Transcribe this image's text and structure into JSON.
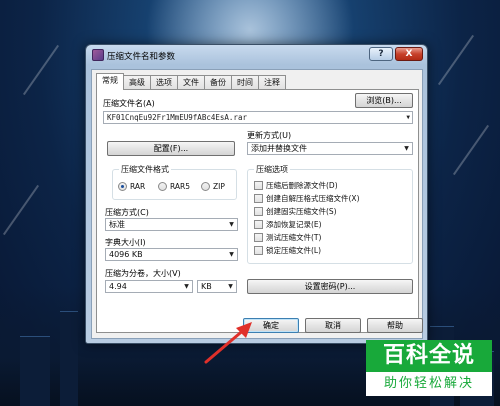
{
  "window": {
    "title": "压缩文件名和参数",
    "help_label": "?",
    "close_label": "X"
  },
  "tabs": [
    "常规",
    "高级",
    "选项",
    "文件",
    "备份",
    "时间",
    "注释"
  ],
  "general": {
    "archive_name_label": "压缩文件名(A)",
    "browse_label": "浏览(B)...",
    "archive_name_value": "KF01CnqEu92Fr1MmEU9fABc4EsA.rar",
    "update_mode_label": "更新方式(U)",
    "update_mode_value": "添加并替换文件",
    "profiles_label": "配置(F)...",
    "format_group_label": "压缩文件格式",
    "formats": [
      {
        "label": "RAR",
        "selected": true
      },
      {
        "label": "RAR5",
        "selected": false
      },
      {
        "label": "ZIP",
        "selected": false
      }
    ],
    "method_label": "压缩方式(C)",
    "method_value": "标准",
    "dict_label": "字典大小(I)",
    "dict_value": "4096 KB",
    "split_label": "压缩为分卷，大小(V)",
    "split_value": "4.94",
    "split_unit": "KB",
    "options_group_label": "压缩选项",
    "options": [
      "压缩后删除源文件(D)",
      "创建自解压格式压缩文件(X)",
      "创建固实压缩文件(S)",
      "添加恢复记录(E)",
      "测试压缩文件(T)",
      "锁定压缩文件(L)"
    ],
    "password_label": "设置密码(P)..."
  },
  "footer": {
    "ok_label": "确定",
    "cancel_label": "取消",
    "help_label": "帮助"
  },
  "watermark": {
    "top": "百科全说",
    "bottom": "助你轻松解决"
  },
  "colors": {
    "accent_arrow": "#e0302a",
    "watermark_green": "#18a93a"
  }
}
